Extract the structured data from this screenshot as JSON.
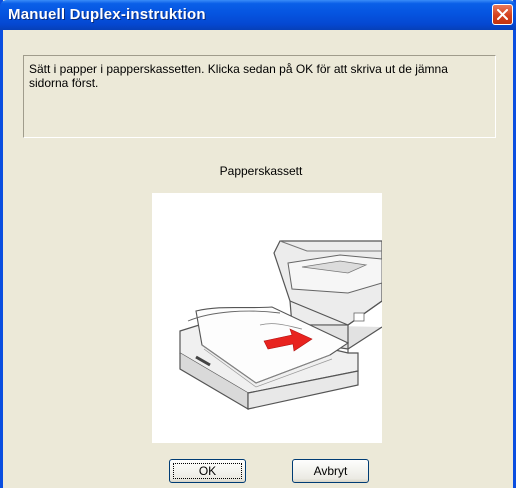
{
  "window": {
    "title": "Manuell Duplex-instruktion",
    "close_icon": "close-icon"
  },
  "message": "Sätt i papper i papperskassetten. Klicka sedan på OK för att skriva ut de jämna sidorna först.",
  "illustration": {
    "label": "Papperskassett",
    "icon": "printer-paper-tray-illustration",
    "arrow_color": "#e8231f"
  },
  "buttons": {
    "ok": "OK",
    "cancel": "Avbryt"
  },
  "colors": {
    "title_bar": "#0554e0",
    "dialog_bg": "#ece9d8",
    "close_button": "#d4411e"
  }
}
